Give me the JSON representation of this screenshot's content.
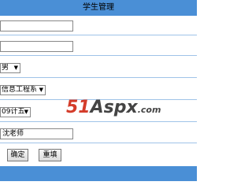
{
  "header": {
    "title": "学生管理"
  },
  "form": {
    "name_value": "",
    "id_value": "",
    "gender_value": "男",
    "department_value": "信息工程系",
    "class_value": "09计五",
    "teacher_value": "沈老师"
  },
  "buttons": {
    "confirm_label": "确定",
    "cancel_label": "重填"
  },
  "watermark": {
    "part1": "51",
    "part2": "Aspx",
    "part3": ".com"
  },
  "colors": {
    "header_bg": "#4a8fd6",
    "row_border": "#9fc3e8",
    "watermark_red": "#d43c2a"
  },
  "icons": {
    "dropdown": "chevron-down-icon"
  }
}
